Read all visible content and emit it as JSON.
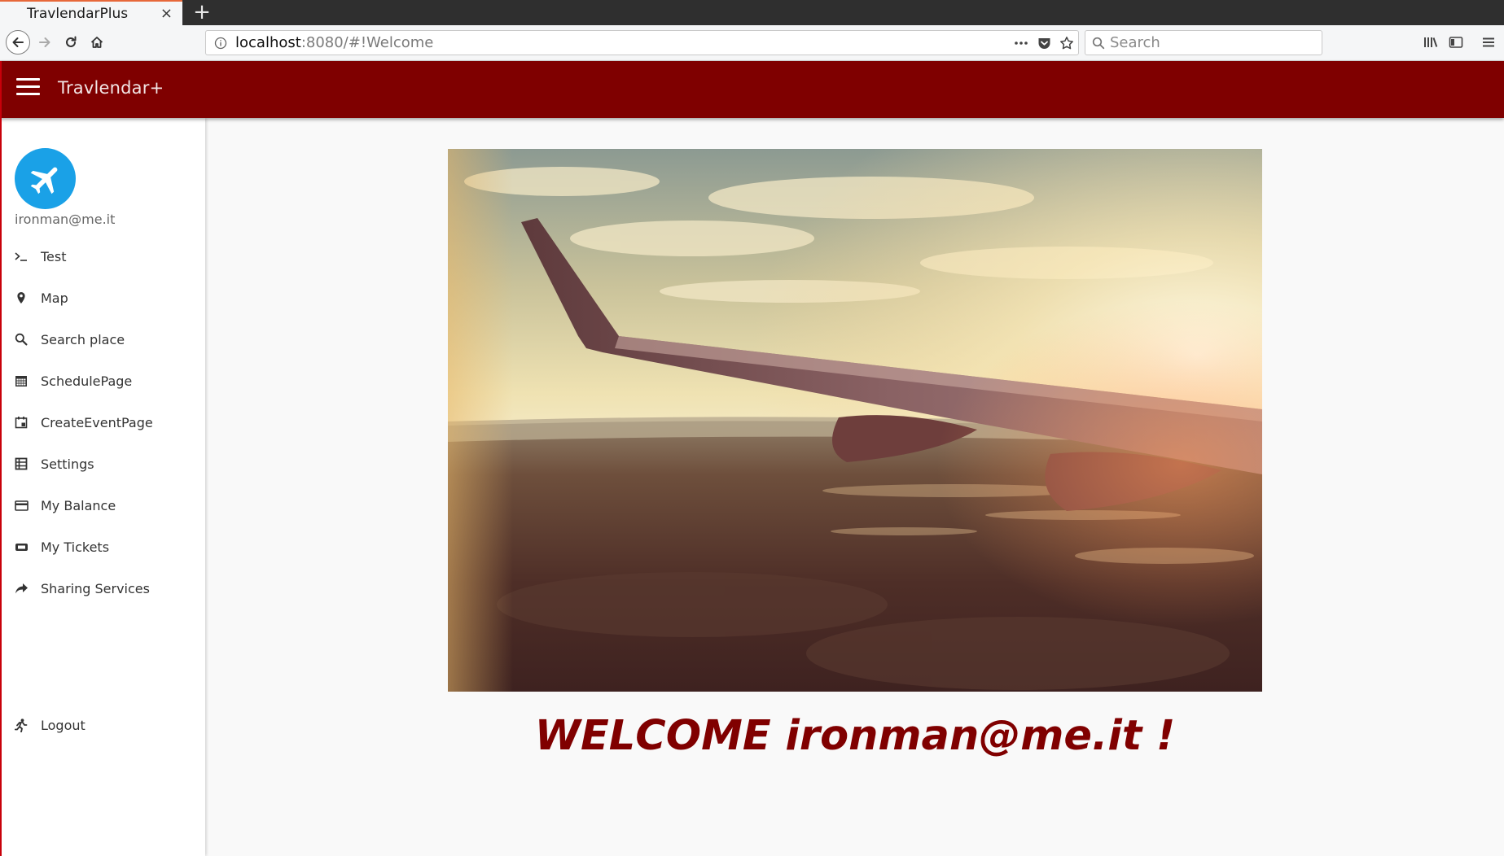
{
  "browser": {
    "tab_title": "TravlendarPlus",
    "tab_close": "×",
    "new_tab": "+",
    "url_host": "localhost",
    "url_rest": ":8080/#!Welcome",
    "search_placeholder": "Search"
  },
  "app": {
    "title": "Travlendar+",
    "brand_color": "#7f0000"
  },
  "sidebar": {
    "user_email": "ironman@me.it",
    "items": [
      {
        "label": "Test",
        "icon": "terminal-icon"
      },
      {
        "label": "Map",
        "icon": "map-pin-icon"
      },
      {
        "label": "Search place",
        "icon": "search-icon"
      },
      {
        "label": "SchedulePage",
        "icon": "calendar-grid-icon"
      },
      {
        "label": "CreateEventPage",
        "icon": "calendar-add-icon"
      },
      {
        "label": "Settings",
        "icon": "table-icon"
      },
      {
        "label": "My Balance",
        "icon": "credit-card-icon"
      },
      {
        "label": "My Tickets",
        "icon": "ticket-icon"
      },
      {
        "label": "Sharing Services",
        "icon": "share-arrow-icon"
      }
    ],
    "logout_label": "Logout"
  },
  "main": {
    "welcome_text": "WELCOME ironman@me.it !"
  }
}
